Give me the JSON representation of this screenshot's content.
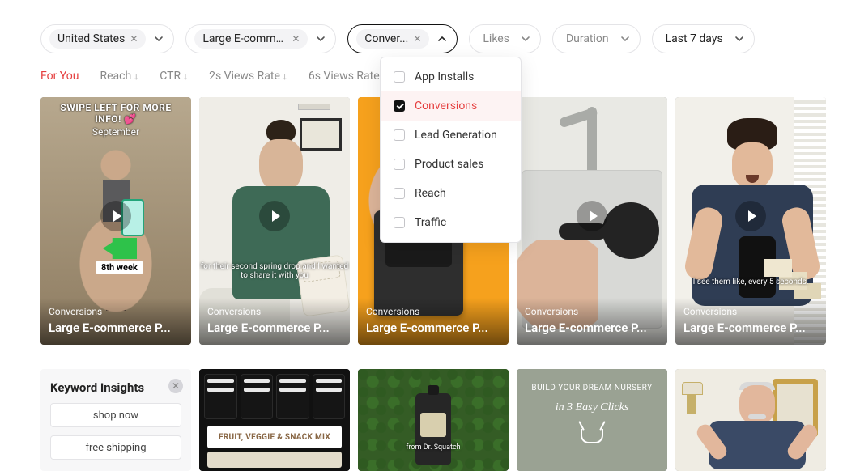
{
  "filters": {
    "region": "United States",
    "category": "Large E-comme...",
    "objective": "Conver...",
    "likes_label": "Likes",
    "duration_label": "Duration",
    "time_label": "Last 7 days"
  },
  "objective_options": [
    "App Installs",
    "Conversions",
    "Lead Generation",
    "Product sales",
    "Reach",
    "Traffic"
  ],
  "objective_selected": "Conversions",
  "sort": {
    "for_you": "For You",
    "reach": "Reach",
    "ctr": "CTR",
    "views2s": "2s Views Rate",
    "views6s": "6s Views Rate"
  },
  "row1": [
    {
      "tag": "Conversions",
      "title": "Large E-commerce P...",
      "swipe1": "SWIPE LEFT FOR MORE",
      "swipe2": "INFO! 💕",
      "month": "September",
      "week": "8th week"
    },
    {
      "tag": "Conversions",
      "title": "Large E-commerce P...",
      "subtitle": "for their second spring drop and I wanted to share it with you"
    },
    {
      "tag": "Conversions",
      "title": "Large E-commerce P..."
    },
    {
      "tag": "Conversions",
      "title": "Large E-commerce P..."
    },
    {
      "tag": "Conversions",
      "title": "Large E-commerce P...",
      "subtitle": "I see them like, every 5 seconds."
    }
  ],
  "keyword_insights": {
    "title": "Keyword Insights",
    "chips": [
      "shop now",
      "free shipping"
    ]
  },
  "row2": {
    "card2_label": "FRUIT, VEGGIE & SNACK MIX",
    "card3_subtitle": "from Dr. Squatch",
    "card4_headline": "BUILD YOUR DREAM NURSERY",
    "card4_sub": "in 3 Easy Clicks"
  }
}
